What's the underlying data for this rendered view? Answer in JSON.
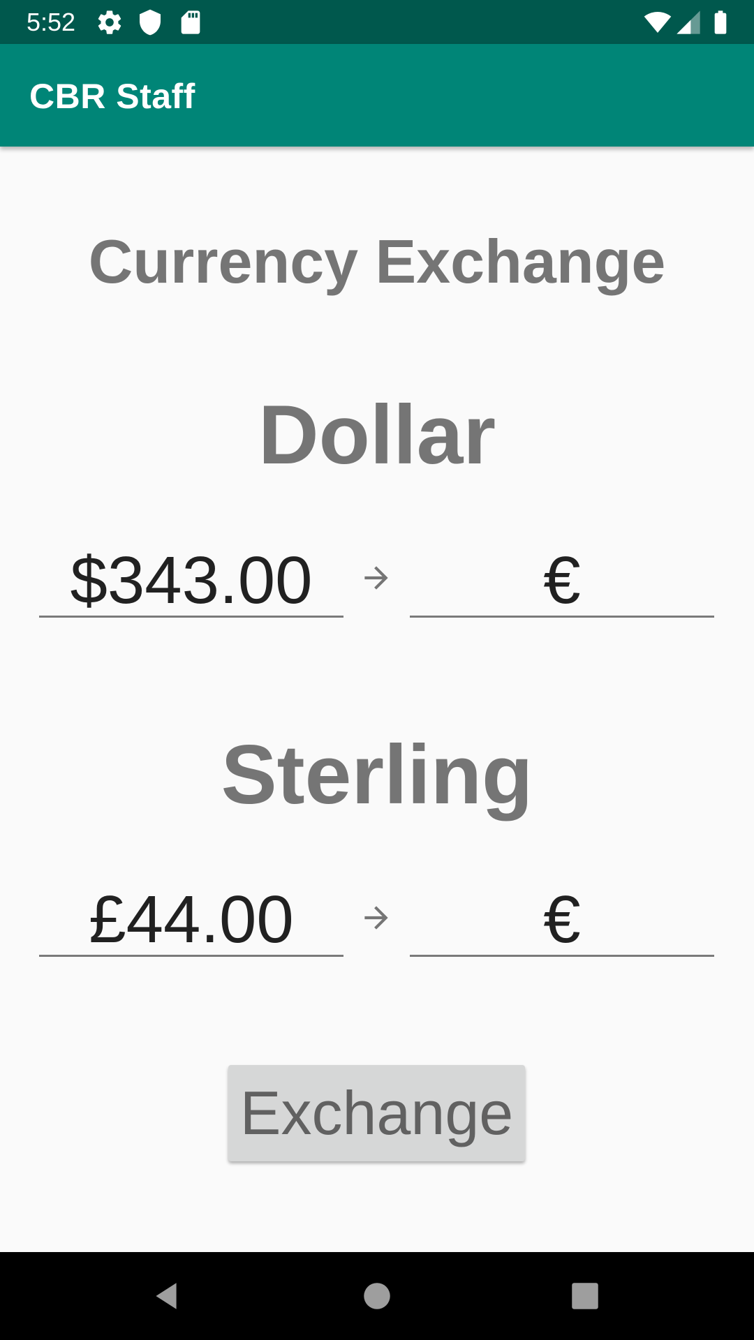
{
  "status_bar": {
    "time": "5:52",
    "icons": [
      "gear-icon",
      "shield-icon",
      "sd-card-icon",
      "wifi-icon",
      "signal-icon",
      "battery-icon"
    ],
    "color": "#00584d"
  },
  "app_bar": {
    "title": "CBR Staff",
    "color": "#008577"
  },
  "main": {
    "title": "Currency Exchange",
    "sections": [
      {
        "label": "Dollar",
        "from_value": "$343.00",
        "to_value": "€"
      },
      {
        "label": "Sterling",
        "from_value": "£44.00",
        "to_value": "€"
      }
    ],
    "exchange_button": "Exchange"
  },
  "nav_bar": {
    "icons": [
      "back-icon",
      "home-icon",
      "recents-icon"
    ]
  }
}
